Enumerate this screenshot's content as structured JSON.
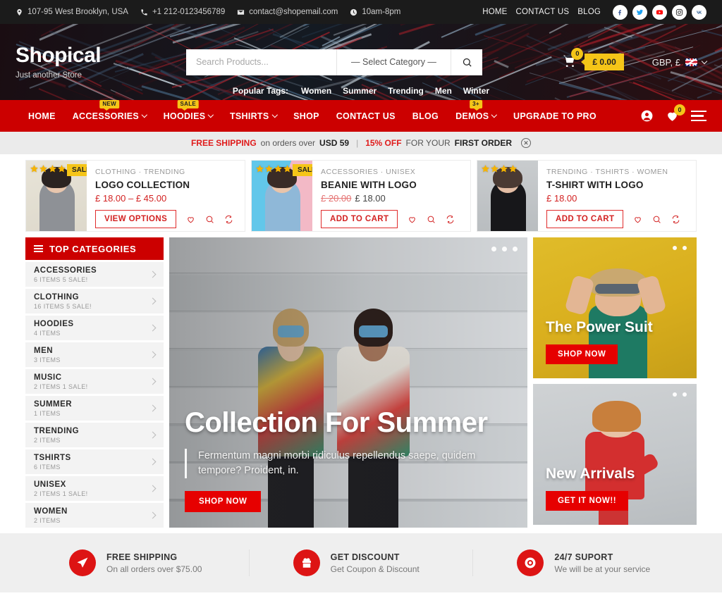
{
  "topbar": {
    "address": "107-95 West Brooklyn, USA",
    "phone": "+1 212-0123456789",
    "email": "contact@shopemail.com",
    "hours": "10am-8pm",
    "links": [
      "HOME",
      "CONTACT US",
      "BLOG"
    ],
    "socials": [
      "facebook-icon",
      "twitter-icon",
      "youtube-icon",
      "instagram-icon",
      "vk-icon"
    ]
  },
  "header": {
    "logo": "Shopical",
    "tagline": "Just another Store",
    "search_placeholder": "Search Products...",
    "search_value": "",
    "category_select": "— Select Category —",
    "cart_count": "0",
    "cart_total": "£ 0.00",
    "currency": "GBP, £",
    "popular_tags_label": "Popular Tags:",
    "popular_tags": [
      "Women",
      "Summer",
      "Trending",
      "Men",
      "Winter"
    ]
  },
  "nav": {
    "items": [
      {
        "label": "HOME",
        "caret": false,
        "badge": ""
      },
      {
        "label": "ACCESSORIES",
        "caret": true,
        "badge": "NEW"
      },
      {
        "label": "HOODIES",
        "caret": true,
        "badge": "SALE"
      },
      {
        "label": "TSHIRTS",
        "caret": true,
        "badge": ""
      },
      {
        "label": "SHOP",
        "caret": false,
        "badge": ""
      },
      {
        "label": "CONTACT US",
        "caret": false,
        "badge": ""
      },
      {
        "label": "BLOG",
        "caret": false,
        "badge": ""
      },
      {
        "label": "DEMOS",
        "caret": true,
        "badge": "3+"
      },
      {
        "label": "UPGRADE TO PRO",
        "caret": false,
        "badge": ""
      }
    ],
    "wishlist_count": "0"
  },
  "promo": {
    "free_shipping": "FREE SHIPPING",
    "mid1": "on orders over",
    "usd": "USD 59",
    "discount": "15% OFF",
    "mid2": "FOR YOUR",
    "first_order": "FIRST ORDER",
    "close": "✕"
  },
  "products": [
    {
      "categories": "CLOTHING · TRENDING",
      "title": "LOGO COLLECTION",
      "price_old": "",
      "price": "£ 18.00 – £ 45.00",
      "button": "VIEW OPTIONS",
      "stars": 5,
      "sale": "SALE!"
    },
    {
      "categories": "ACCESSORIES · UNISEX",
      "title": "BEANIE WITH LOGO",
      "price_old": "£ 20.00",
      "price": "£ 18.00",
      "button": "ADD TO CART",
      "stars": 5,
      "sale": "SALE!"
    },
    {
      "categories": "TRENDING · TSHIRTS · WOMEN",
      "title": "T-SHIRT WITH LOGO",
      "price_old": "",
      "price": "£ 18.00",
      "button": "ADD TO CART",
      "stars": 4,
      "sale": ""
    }
  ],
  "sidebar": {
    "heading": "TOP CATEGORIES",
    "categories": [
      {
        "name": "ACCESSORIES",
        "meta": "6 ITEMS  5 SALE!"
      },
      {
        "name": "CLOTHING",
        "meta": "16 ITEMS  5 SALE!"
      },
      {
        "name": "HOODIES",
        "meta": "4 ITEMS"
      },
      {
        "name": "MEN",
        "meta": "3 ITEMS"
      },
      {
        "name": "MUSIC",
        "meta": "2 ITEMS  1 SALE!"
      },
      {
        "name": "SUMMER",
        "meta": "1 ITEMS"
      },
      {
        "name": "TRENDING",
        "meta": "2 ITEMS"
      },
      {
        "name": "TSHIRTS",
        "meta": "6 ITEMS"
      },
      {
        "name": "UNISEX",
        "meta": "2 ITEMS  1 SALE!"
      },
      {
        "name": "WOMEN",
        "meta": "2 ITEMS"
      }
    ]
  },
  "hero": {
    "title": "Collection For Summer",
    "subtitle": "Fermentum magni morbi ridiculus repellendus saepe, quidem tempore? Proident, in.",
    "button": "SHOP NOW"
  },
  "promo_cards": [
    {
      "title": "The Power Suit",
      "button": "SHOP NOW"
    },
    {
      "title": "New Arrivals",
      "button": "GET IT NOW!!"
    }
  ],
  "features": [
    {
      "icon": "paper-plane-icon",
      "title": "FREE SHIPPING",
      "sub": "On all orders over $75.00"
    },
    {
      "icon": "gift-icon",
      "title": "GET DISCOUNT",
      "sub": "Get Coupon & Discount"
    },
    {
      "icon": "lifebuoy-icon",
      "title": "24/7 SUPORT",
      "sub": "We will be at your service"
    }
  ],
  "colors": {
    "brand_red": "#cc0000",
    "accent_yellow": "#f5c518",
    "dark": "#1b1b1b"
  }
}
